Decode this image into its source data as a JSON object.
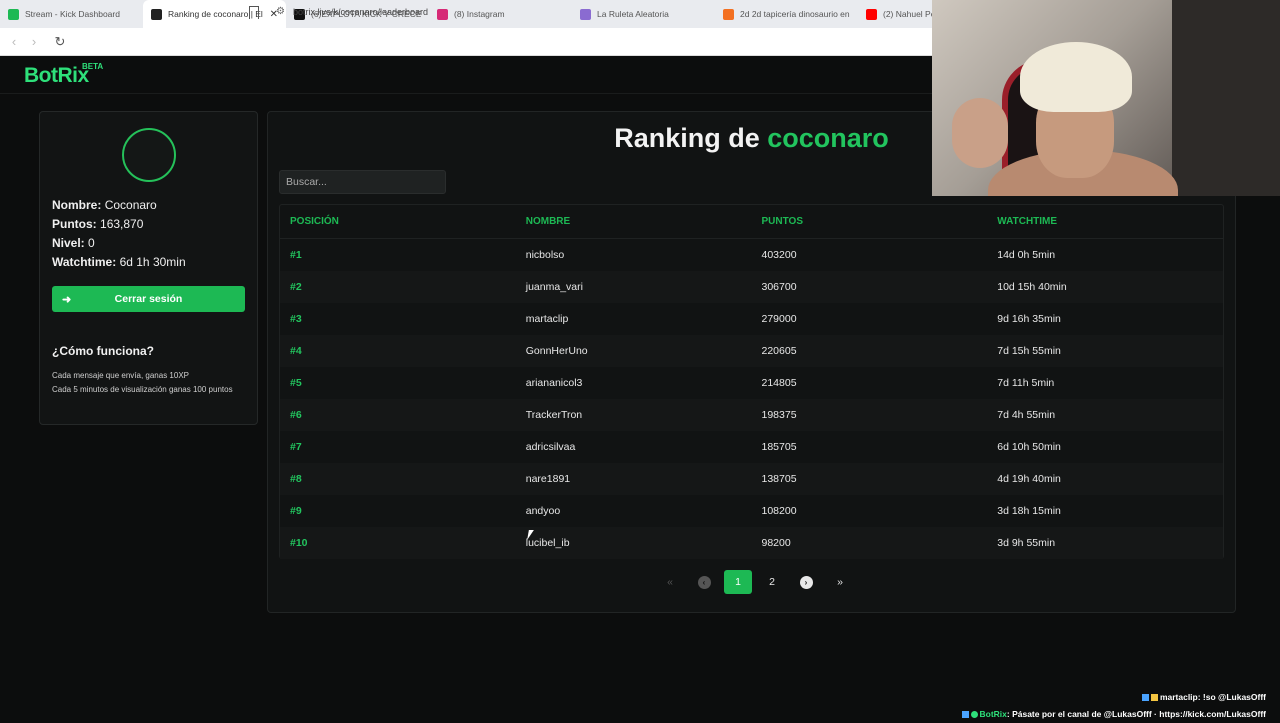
{
  "browser": {
    "tabs": [
      {
        "title": "Stream - Kick Dashboard",
        "icon": "kick-icon",
        "color": "#1db954",
        "active": false
      },
      {
        "title": "Ranking de coconaro | El",
        "icon": "botrix-icon",
        "color": "#222222",
        "active": true,
        "close": "✕"
      },
      {
        "title": "(6)EXPLOTA KICK Y CRECE TU C",
        "icon": "tiktok-icon",
        "color": "#111111",
        "active": false
      },
      {
        "title": "(8) Instagram",
        "icon": "instagram-icon",
        "color": "#d62976",
        "active": false
      },
      {
        "title": "La Ruleta Aleatoria",
        "icon": "wheel-icon",
        "color": "#8a6bd1",
        "active": false
      },
      {
        "title": "2d 2d tapicería dinosaurio en",
        "icon": "shop-icon",
        "color": "#f37021",
        "active": false
      },
      {
        "title": "(2) Nahuel Per",
        "icon": "youtube-icon",
        "color": "#ff0000",
        "active": false
      }
    ],
    "url": "botrix.live/k/coconaro/leaderboard"
  },
  "brand": {
    "name": "BotRix",
    "badge": "BETA",
    "accent": "#1db954"
  },
  "profile": {
    "name_label": "Nombre:",
    "name": "Coconaro",
    "points_label": "Puntos:",
    "points": "163,870",
    "level_label": "Nivel:",
    "level": "0",
    "watchtime_label": "Watchtime:",
    "watchtime": "6d 1h 30min",
    "logout": "Cerrar sesión",
    "how_title": "¿Cómo funciona?",
    "how_line1": "Cada mensaje que envía, ganas 10XP",
    "how_line2": "Cada 5 minutos de visualización ganas 100 puntos"
  },
  "leaderboard": {
    "title_prefix": "Ranking de",
    "title_name": "coconaro",
    "search_placeholder": "Buscar...",
    "columns": [
      "Posición",
      "Nombre",
      "Puntos",
      "Watchtime"
    ],
    "rows": [
      [
        "#1",
        "nicbolso",
        "403200",
        "14d 0h 5min"
      ],
      [
        "#2",
        "juanma_vari",
        "306700",
        "10d 15h 40min"
      ],
      [
        "#3",
        "martaclip",
        "279000",
        "9d 16h 35min"
      ],
      [
        "#4",
        "GonnHerUno",
        "220605",
        "7d 15h 55min"
      ],
      [
        "#5",
        "ariananicol3",
        "214805",
        "7d 11h 5min"
      ],
      [
        "#6",
        "TrackerTron",
        "198375",
        "7d 4h 55min"
      ],
      [
        "#7",
        "adricsilvaa",
        "185705",
        "6d 10h 50min"
      ],
      [
        "#8",
        "nare1891",
        "138705",
        "4d 19h 40min"
      ],
      [
        "#9",
        "andyoo",
        "108200",
        "3d 18h 15min"
      ],
      [
        "#10",
        "lucibel_ib",
        "98200",
        "3d 9h 55min"
      ]
    ],
    "pagination": {
      "first": "«",
      "prev": "‹",
      "pages": [
        "1",
        "2"
      ],
      "current": "1",
      "next": "›",
      "last": "»"
    }
  },
  "chat_overlay": {
    "line1_user": "martaclip",
    "line1_text": ": !so @LukasOfff",
    "line2_user": "BotRix",
    "line2_text": ": Pásate por el canal de @LukasOfff · https://kick.com/LukasOfff"
  }
}
